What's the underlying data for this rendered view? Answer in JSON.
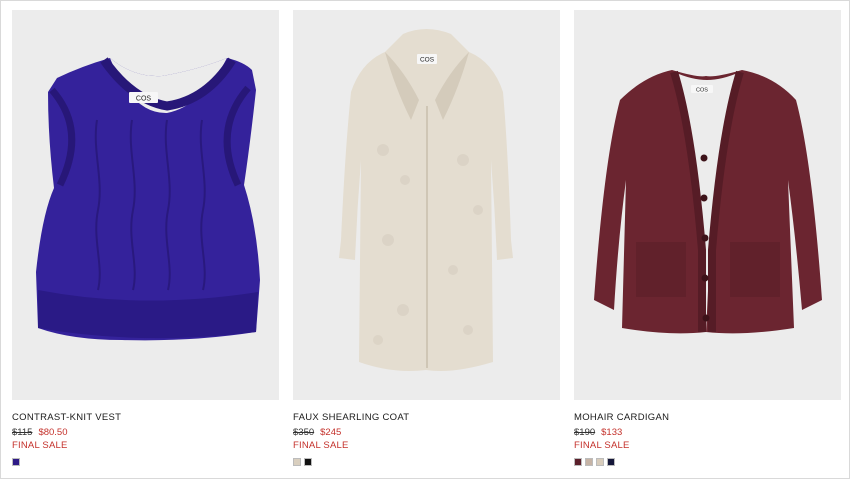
{
  "products": [
    {
      "name": "CONTRAST-KNIT VEST",
      "old_price": "$115",
      "new_price": "$80.50",
      "badge": "FINAL SALE",
      "label": "COS",
      "swatches": [
        "#2e1a86"
      ]
    },
    {
      "name": "FAUX SHEARLING COAT",
      "old_price": "$350",
      "new_price": "$245",
      "badge": "FINAL SALE",
      "label": "COS",
      "swatches": [
        "#d9cfbf",
        "#111111"
      ]
    },
    {
      "name": "MOHAIR CARDIGAN",
      "old_price": "$190",
      "new_price": "$133",
      "badge": "FINAL SALE",
      "label": "COS",
      "swatches": [
        "#5a1f2a",
        "#c6b4a6",
        "#d8ccbb",
        "#15173a"
      ]
    }
  ],
  "colors": {
    "sale_red": "#c4312b",
    "image_bg": "#ececec"
  }
}
